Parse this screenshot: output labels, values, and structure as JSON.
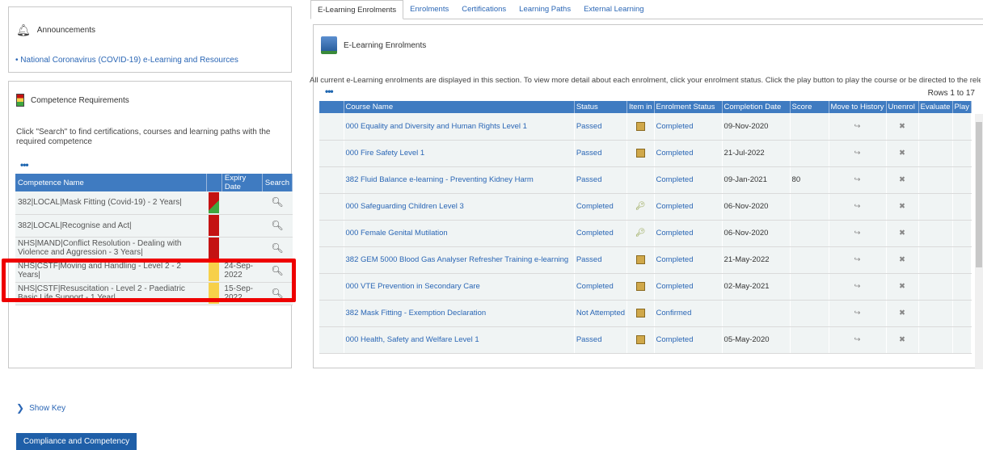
{
  "announcements": {
    "title": "Announcements",
    "items": [
      "National Coronavirus (COVID-19) e-Learning and Resources"
    ]
  },
  "competence": {
    "title": "Competence Requirements",
    "description": "Click \"Search\" to find certifications, courses and learning paths with the required competence",
    "columns": [
      "Competence Name",
      "Expiry Date",
      "Search"
    ],
    "rows": [
      {
        "name": "382|LOCAL|Mask Fitting (Covid-19) - 2 Years|",
        "expiry": "",
        "flag": "red-green"
      },
      {
        "name": "382|LOCAL|Recognise and Act|",
        "expiry": "",
        "flag": "red"
      },
      {
        "name": "NHS|MAND|Conflict Resolution - Dealing with Violence and Aggression - 3 Years|",
        "expiry": "",
        "flag": "red"
      },
      {
        "name": "NHS|CSTF|Moving and Handling - Level 2 - 2 Years|",
        "expiry": "24-Sep-2022",
        "flag": "yellow"
      },
      {
        "name": "NHS|CSTF|Resuscitation - Level 2 - Paediatric Basic Life Support - 1 Year|",
        "expiry": "15-Sep-2022",
        "flag": "yellow"
      }
    ],
    "show_key": "Show Key",
    "button": "Compliance and Competency"
  },
  "tabs": [
    "E-Learning Enrolments",
    "Enrolments",
    "Certifications",
    "Learning Paths",
    "External Learning"
  ],
  "enrolments": {
    "title": "E-Learning Enrolments",
    "subtitle": "All current e-Learning enrolments are displayed in this section. To view more detail about each enrolment, click your enrolment status. Click the play button to play the course or be directed to the relevant screen.",
    "rows_label": "Rows 1 to 17",
    "columns": [
      "Course Name",
      "Status",
      "Item in",
      "Enrolment Status",
      "Completion Date",
      "Score",
      "Move to History",
      "Unenrol",
      "Evaluate",
      "Play"
    ],
    "rows": [
      {
        "course": "000 Equality and Diversity and Human Rights Level 1",
        "status": "Passed",
        "item": "book",
        "enrolment": "Completed",
        "date": "09-Nov-2020",
        "score": ""
      },
      {
        "course": "000 Fire Safety Level 1",
        "status": "Passed",
        "item": "book",
        "enrolment": "Completed",
        "date": "21-Jul-2022",
        "score": ""
      },
      {
        "course": "382 Fluid Balance e-learning - Preventing Kidney Harm",
        "status": "Passed",
        "item": "",
        "enrolment": "Completed",
        "date": "09-Jan-2021",
        "score": "80"
      },
      {
        "course": "000 Safeguarding Children Level 3",
        "status": "Completed",
        "item": "key",
        "enrolment": "Completed",
        "date": "06-Nov-2020",
        "score": ""
      },
      {
        "course": "000 Female Genital Mutilation",
        "status": "Completed",
        "item": "key",
        "enrolment": "Completed",
        "date": "06-Nov-2020",
        "score": ""
      },
      {
        "course": "382 GEM 5000 Blood Gas Analyser Refresher Training e-learning",
        "status": "Passed",
        "item": "book",
        "enrolment": "Completed",
        "date": "21-May-2022",
        "score": ""
      },
      {
        "course": "000 VTE Prevention in Secondary Care",
        "status": "Completed",
        "item": "book",
        "enrolment": "Completed",
        "date": "02-May-2021",
        "score": ""
      },
      {
        "course": "382 Mask Fitting - Exemption Declaration",
        "status": "Not Attempted",
        "item": "book",
        "enrolment": "Confirmed",
        "date": "",
        "score": ""
      },
      {
        "course": "000 Health, Safety and Welfare Level 1",
        "status": "Passed",
        "item": "book",
        "enrolment": "Completed",
        "date": "05-May-2020",
        "score": ""
      }
    ]
  }
}
